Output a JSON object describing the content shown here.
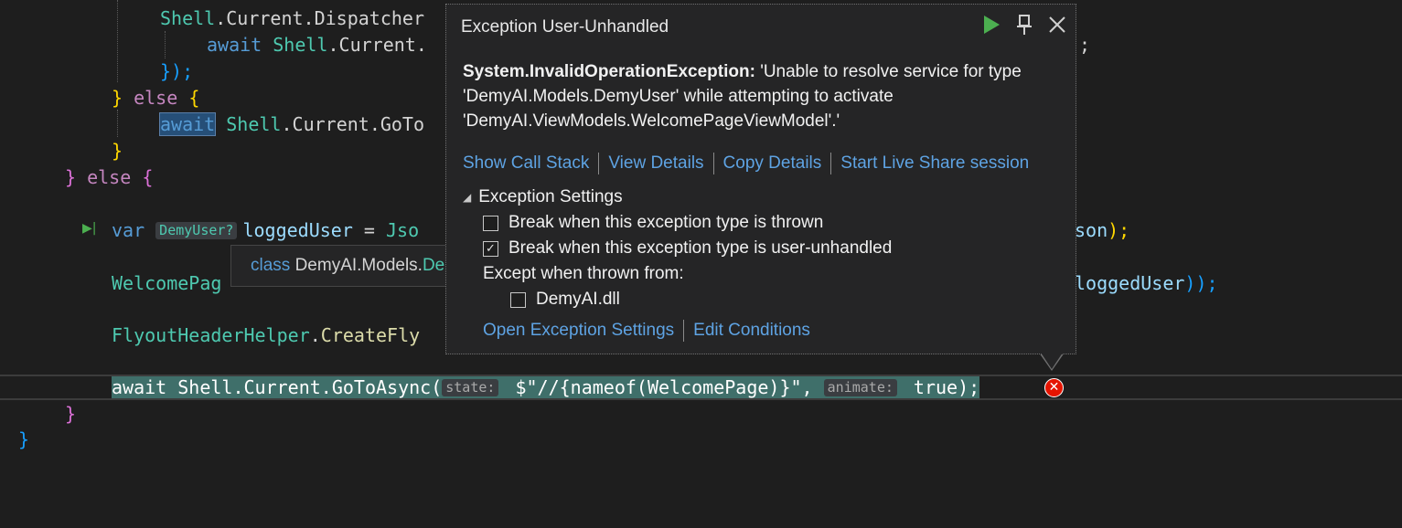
{
  "code": {
    "l1_obj": "Shell",
    "l1_rest": "Current.Dispatcher",
    "l2_kw": "await",
    "l2_obj": "Shell",
    "l2_rest": ".Current.",
    "l2_tail": ";",
    "l3": "});",
    "l4_else": "else",
    "l5_kw": "await",
    "l5_obj": "Shell",
    "l5_rest": ".Current.GoTo",
    "l7_else": "else",
    "l8_kw": "var",
    "l8_hint": "DemyUser?",
    "l8_var": "loggedUser",
    "l8_eq": " = ",
    "l8_json": "Jso",
    "l8_tail_var": "son",
    "l8_tail": ");",
    "l9_type": "WelcomePag",
    "l9_tail_var": "loggedUser",
    "l9_tail": "));",
    "l10_type": "FlyoutHeaderHelper",
    "l10_fn": "CreateFly",
    "l11_kw": "await",
    "l11_body": " Shell.Current.GoToAsync(",
    "l11_hint1": "state:",
    "l11_str": " $\"//{nameof(WelcomePage)}\",",
    "l11_hint2": "animate:",
    "l11_end": " true);"
  },
  "tooltip": {
    "kw": "class",
    "ns": "DemyAI.Models.",
    "type": "DemyUser"
  },
  "popup": {
    "title": "Exception User-Unhandled",
    "exception_name": "System.InvalidOperationException:",
    "message": "'Unable to resolve service for type 'DemyAI.Models.DemyUser' while attempting to activate 'DemyAI.ViewModels.WelcomePageViewModel'.'",
    "links": [
      "Show Call Stack",
      "View Details",
      "Copy Details",
      "Start Live Share session"
    ],
    "settings_header": "Exception Settings",
    "cb_thrown": "Break when this exception type is thrown",
    "cb_unhandled": "Break when this exception type is user-unhandled",
    "except_from": "Except when thrown from:",
    "cb_dll": "DemyAI.dll",
    "links2": [
      "Open Exception Settings",
      "Edit Conditions"
    ]
  },
  "colors": {
    "editor_bg": "#1e1e1e",
    "popup_bg": "#252526",
    "link": "#5ea3e3",
    "run": "#4caf50",
    "error": "#e51400"
  }
}
